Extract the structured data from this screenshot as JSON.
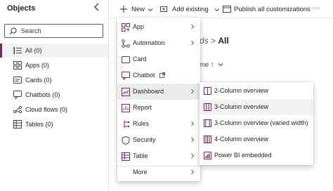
{
  "sidebar": {
    "title": "Objects",
    "search_placeholder": "Search",
    "items": [
      {
        "label": "All (0)",
        "icon": "list-icon"
      },
      {
        "label": "Apps (0)",
        "icon": "apps-icon"
      },
      {
        "label": "Cards (0)",
        "icon": "cards-icon"
      },
      {
        "label": "Chatbots (0)",
        "icon": "chatbot-icon"
      },
      {
        "label": "Cloud flows (0)",
        "icon": "flow-icon"
      },
      {
        "label": "Tables (0)",
        "icon": "table-icon"
      }
    ]
  },
  "toolbar": {
    "new_label": "New",
    "add_existing_label": "Add existing",
    "publish_label": "Publish all customizations",
    "more_label": "···"
  },
  "main": {
    "breadcrumb_prev": "ds",
    "breadcrumb_sep": ">",
    "breadcrumb_current": "All",
    "column_header": "me ↑"
  },
  "new_menu": {
    "items": [
      {
        "label": "App",
        "icon": "app-icon",
        "has_submenu": true
      },
      {
        "label": "Automation",
        "icon": "automation-icon",
        "has_submenu": true
      },
      {
        "label": "Card",
        "icon": "card-icon",
        "has_submenu": false
      },
      {
        "label": "Chatbot",
        "icon": "chatbot-icon",
        "has_submenu": false,
        "external": true
      },
      {
        "label": "Dashboard",
        "icon": "dashboard-icon",
        "has_submenu": true
      },
      {
        "label": "Report",
        "icon": "report-icon",
        "has_submenu": false
      },
      {
        "label": "Rules",
        "icon": "rules-icon",
        "has_submenu": true
      },
      {
        "label": "Security",
        "icon": "security-icon",
        "has_submenu": true
      },
      {
        "label": "Table",
        "icon": "table-icon",
        "has_submenu": true
      },
      {
        "label": "More",
        "icon": "",
        "has_submenu": true
      }
    ],
    "active_item": "Dashboard"
  },
  "dashboard_submenu": {
    "items": [
      {
        "label": "2-Column overview",
        "icon": "two-column-icon"
      },
      {
        "label": "3-Column overview",
        "icon": "three-column-icon"
      },
      {
        "label": "3-Column overview (varied width)",
        "icon": "three-column-varied-icon"
      },
      {
        "label": "4-Column overview",
        "icon": "four-column-icon"
      },
      {
        "label": "Power BI embedded",
        "icon": "power-bi-icon"
      }
    ],
    "hovered_item": "3-Column overview"
  },
  "colors": {
    "accent": "#742774",
    "selected_bg": "#edebe9",
    "hover_bg": "#f3f2f1"
  }
}
